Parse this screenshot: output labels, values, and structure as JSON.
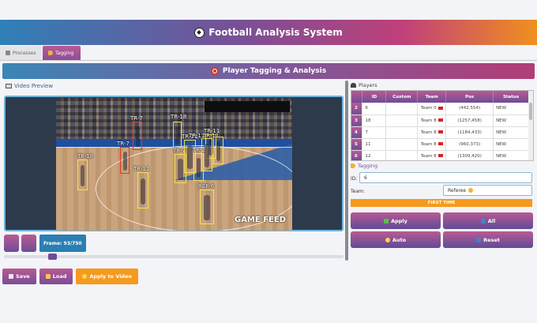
{
  "header": {
    "title": "Football Analysis System",
    "icon": "soccer-ball-icon"
  },
  "tabs": [
    {
      "label": "Processes",
      "icon": "processes-icon",
      "active": false
    },
    {
      "label": "Tagging",
      "icon": "tag-icon",
      "active": true
    }
  ],
  "section": {
    "title": "Player Tagging & Analysis",
    "icon": "target-icon"
  },
  "video": {
    "label": "Video Preview",
    "watermark": "GAME FEED",
    "frame_label": "Frame: 93/750",
    "slider_progress": 0.13,
    "detections": [
      {
        "label": "TR-7",
        "color": "red"
      },
      {
        "label": "TR-18",
        "color": "yellow"
      },
      {
        "label": "TR-11",
        "color": "yellow"
      },
      {
        "label": "TR-7",
        "color": "red"
      },
      {
        "label": "TR-18",
        "color": "yellow"
      },
      {
        "label": "TR-11",
        "color": "yellow"
      },
      {
        "label": "TR-7",
        "color": "yellow"
      },
      {
        "label": "TR-11",
        "color": "yellow"
      },
      {
        "label": "TR-11",
        "color": "yellow"
      },
      {
        "label": "TR-11",
        "color": "yellow"
      },
      {
        "label": "TR-2",
        "color": "yellow"
      },
      {
        "label": "REF-6",
        "color": "yellow"
      }
    ]
  },
  "bottom": {
    "save": "Save",
    "load": "Load",
    "apply_to_video": "Apply to Video"
  },
  "players": {
    "label": "Players",
    "columns": [
      "",
      "ID",
      "Custom",
      "Team",
      "Pos",
      "Status"
    ],
    "rows": [
      {
        "idx": "2",
        "id": "6",
        "custom": "",
        "team": "Team 0",
        "pos": "(442,554)",
        "status": "NEW"
      },
      {
        "idx": "3",
        "id": "18",
        "custom": "",
        "team": "Team 8",
        "pos": "(1257,458)",
        "status": "NEW"
      },
      {
        "idx": "4",
        "id": "7",
        "custom": "",
        "team": "Team 8",
        "pos": "(1184,433)",
        "status": "NEW"
      },
      {
        "idx": "5",
        "id": "11",
        "custom": "",
        "team": "Team 8",
        "pos": "(960,373)",
        "status": "NEW"
      },
      {
        "idx": "6",
        "id": "12",
        "custom": "",
        "team": "Team 8",
        "pos": "(1309,420)",
        "status": "NEW"
      }
    ]
  },
  "tagging": {
    "label": "Tagging",
    "id_label": "ID:",
    "id_value": "6",
    "team_label": "Team:",
    "team_value": "Referee",
    "first_time": "FIRST TIME",
    "apply": "Apply",
    "all": "All",
    "auto": "Auto",
    "reset": "Reset"
  },
  "colors": {
    "accent_purple": "#7a4c98",
    "accent_orange": "#f59a1e",
    "accent_blue": "#2b7fb3"
  }
}
